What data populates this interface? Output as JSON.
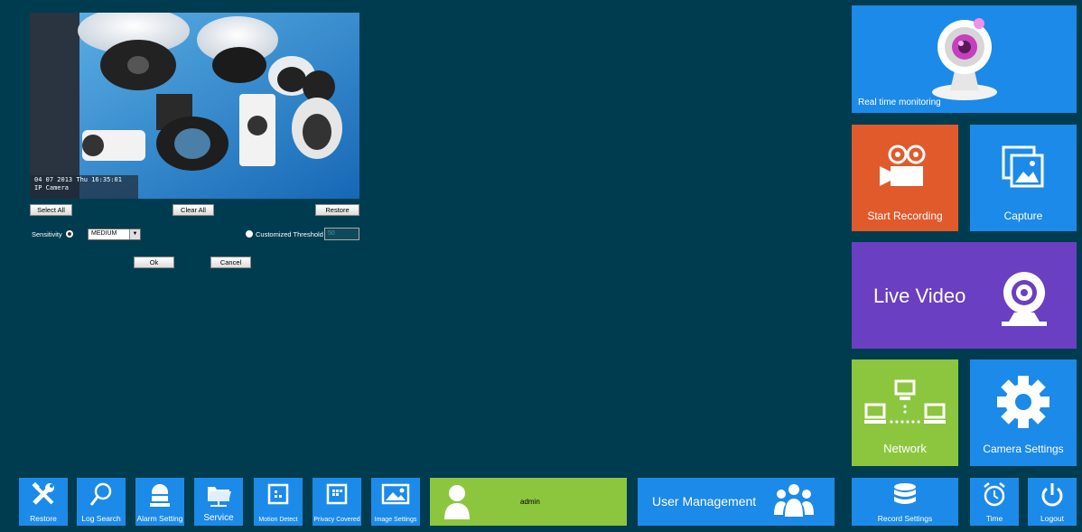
{
  "camera": {
    "overlay_line1": "04 07 2013 Thu 16:35:01",
    "overlay_line2": "IP Camera"
  },
  "controls": {
    "select_all": "Select All",
    "clear_all": "Clear All",
    "restore": "Restore",
    "sensitivity_label": "Sensitivity",
    "sensitivity_value": "MEDIUM",
    "customized_threshold_label": "Customized Threshold",
    "threshold_value": "50",
    "ok": "Ok",
    "cancel": "Cancel"
  },
  "tiles": {
    "realtime": "Real time monitoring",
    "start_recording": "Start Recording",
    "capture": "Capture",
    "live_video": "Live Video",
    "network": "Network",
    "camera_settings": "Camera Settings",
    "record_settings": "Record Settings",
    "time": "Time",
    "logout": "Logout"
  },
  "bottom_bar": {
    "restore": "Restore",
    "log_search": "Log Search",
    "alarm_setting": "Alarm Setting",
    "service": "Service",
    "motion_detect": "Motion Detect",
    "privacy_covered": "Privacy Covered",
    "image_settings": "Image Settings",
    "user_name": "admin",
    "user_management": "User Management"
  },
  "colors": {
    "background": "#003c4f",
    "tile_blue": "#1c8ae8",
    "tile_orange": "#e05a2c",
    "tile_purple": "#6a3fc1",
    "tile_green": "#8cc63e"
  }
}
